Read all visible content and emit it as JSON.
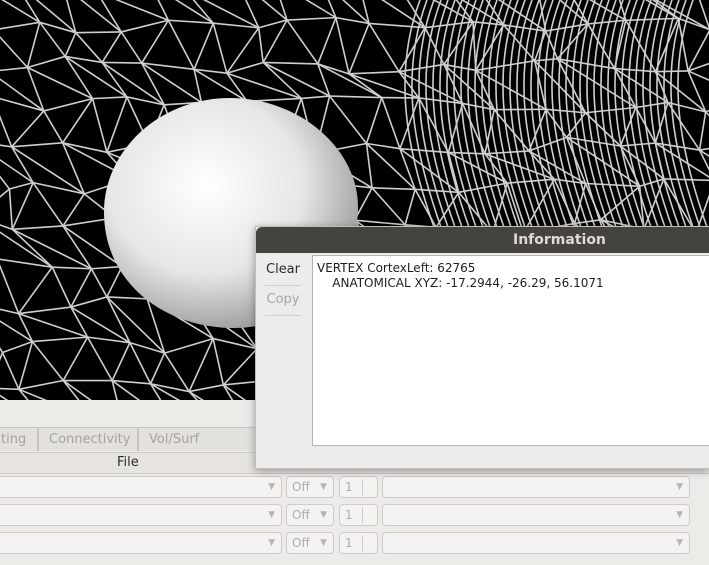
{
  "tabs": [
    "ting",
    "Connectivity",
    "Vol/Surf Outline"
  ],
  "table": {
    "header": "File",
    "rows": [
      {
        "file": "",
        "status": "Off",
        "count": "1",
        "extra": ""
      },
      {
        "file": "",
        "status": "Off",
        "count": "1",
        "extra": ""
      },
      {
        "file": "",
        "status": "Off",
        "count": "1",
        "extra": ""
      }
    ]
  },
  "dialog": {
    "title": "Information",
    "clear_label": "Clear",
    "copy_label": "Copy",
    "lines": [
      "VERTEX CortexLeft: 62765",
      "    ANATOMICAL XYZ: -17.2944, -26.29, 56.1071"
    ]
  },
  "colors": {
    "viewport_bg": "#000000",
    "mesh": "#d0d0d0",
    "titlebar": "#45433f"
  }
}
